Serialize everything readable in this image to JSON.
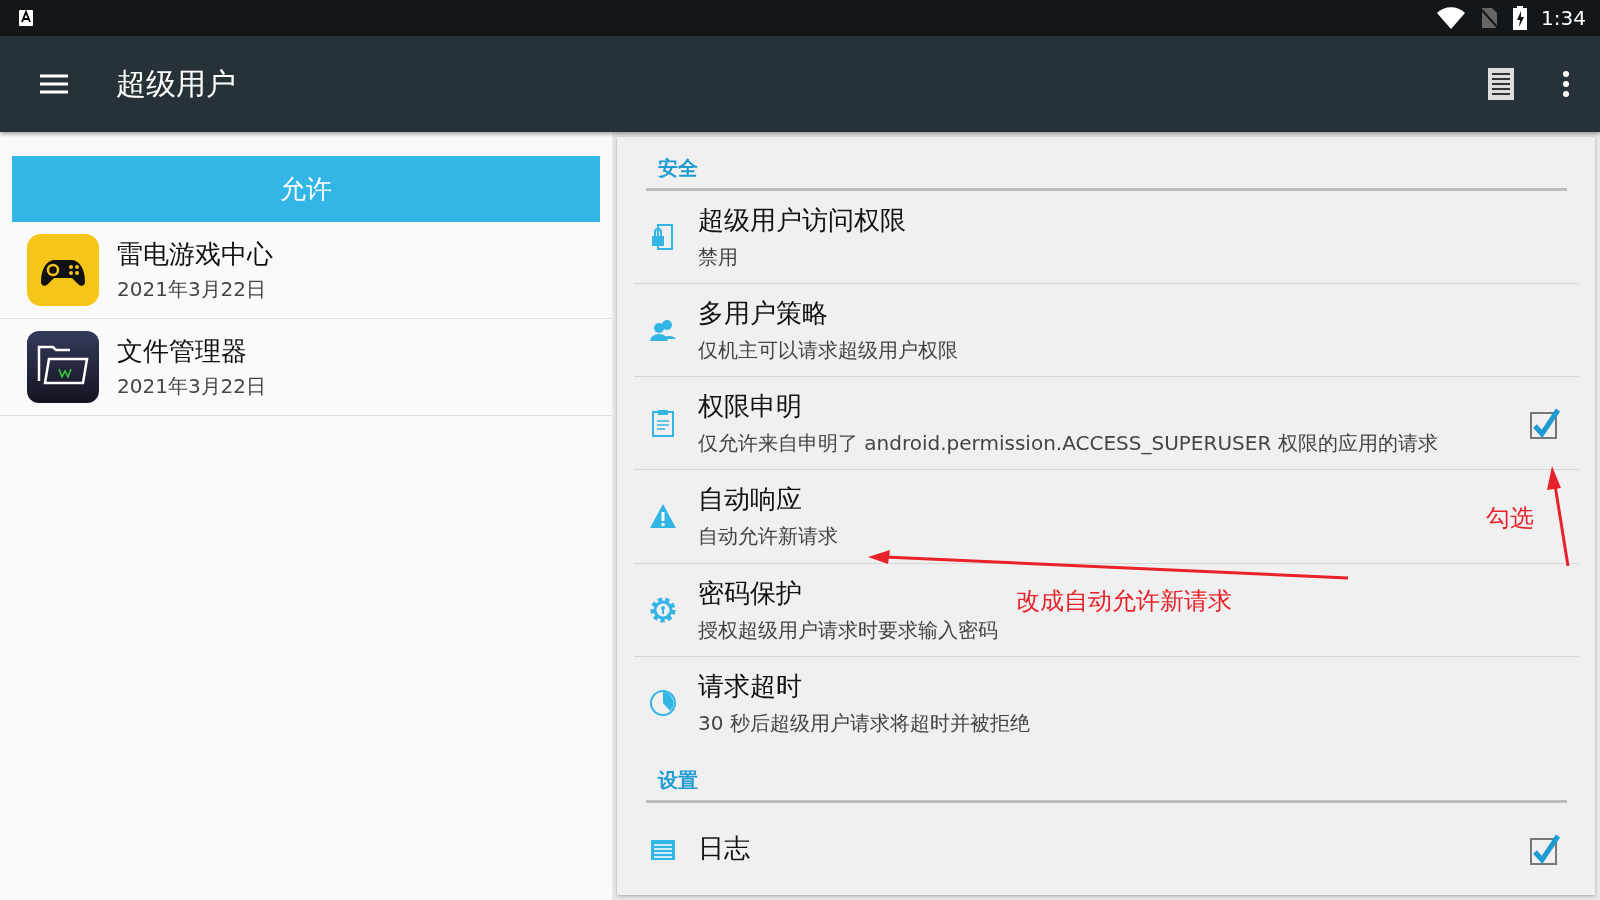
{
  "status_bar": {
    "time": "1:34"
  },
  "app_bar": {
    "title": "超级用户"
  },
  "left_panel": {
    "tabs": [
      {
        "label": "允许",
        "selected": true
      }
    ],
    "apps": [
      {
        "name": "雷电游戏中心",
        "date": "2021年3月22日",
        "kind": "gamepad"
      },
      {
        "name": "文件管理器",
        "date": "2021年3月22日",
        "kind": "folder"
      }
    ]
  },
  "settings": {
    "sections": [
      {
        "title": "安全",
        "items": [
          {
            "title": "超级用户访问权限",
            "summary": "禁用",
            "kind": "plain"
          },
          {
            "title": "多用户策略",
            "summary": "仅机主可以请求超级用户权限",
            "kind": "plain"
          },
          {
            "title": "权限申明",
            "summary": "仅允许来自申明了 android.permission.ACCESS_SUPERUSER 权限的应用的请求",
            "kind": "checkbox",
            "checked": true
          },
          {
            "title": "自动响应",
            "summary": "自动允许新请求",
            "kind": "plain"
          },
          {
            "title": "密码保护",
            "summary": "授权超级用户请求时要求输入密码",
            "kind": "plain"
          },
          {
            "title": "请求超时",
            "summary": "30 秒后超级用户请求将超时并被拒绝",
            "kind": "plain"
          }
        ]
      },
      {
        "title": "设置",
        "items": [
          {
            "title": "日志",
            "kind": "checkbox",
            "checked": true
          }
        ]
      }
    ]
  },
  "annotations": [
    {
      "text": "勾选"
    },
    {
      "text": "改成自动允许新请求"
    }
  ]
}
